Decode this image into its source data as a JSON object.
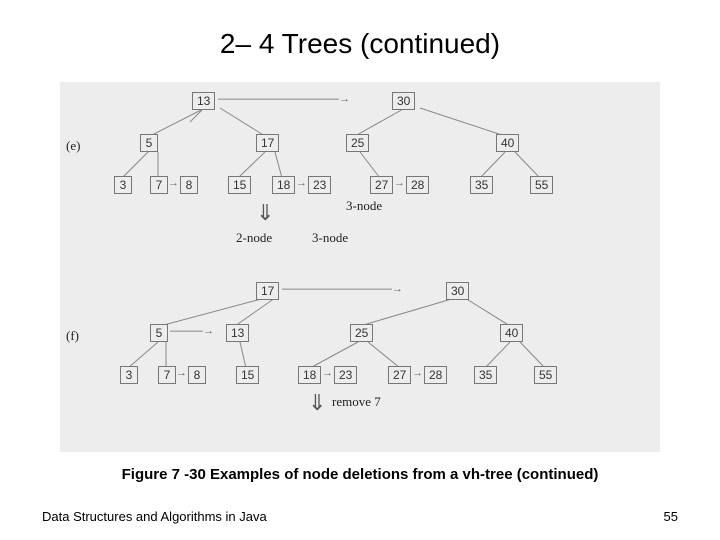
{
  "title": "2– 4 Trees (continued)",
  "panels": {
    "e": {
      "label": "(e)"
    },
    "f": {
      "label": "(f)"
    }
  },
  "treeE": {
    "root": {
      "a": "13",
      "b": "30"
    },
    "l1": {
      "n5": "5",
      "n17": "17",
      "n25": "25",
      "n40": "40"
    },
    "l2": {
      "n3": "3",
      "n7": "7",
      "n8": "8",
      "n15": "15",
      "n18": "18",
      "n23": "23",
      "n27": "27",
      "n28": "28",
      "n35": "35",
      "n55": "55"
    },
    "notes": {
      "threeNode": "3-node",
      "twoNode": "2-node",
      "threeNodeB": "3-node"
    }
  },
  "treeF": {
    "root": {
      "a": "17",
      "b": "30"
    },
    "l1": {
      "n5": "5",
      "n13": "13",
      "n25": "25",
      "n40": "40"
    },
    "l2": {
      "n3": "3",
      "n7": "7",
      "n8": "8",
      "n15": "15",
      "n18": "18",
      "n23": "23",
      "n27": "27",
      "n28": "28",
      "n35": "35",
      "n55": "55"
    },
    "notes": {
      "remove": "remove 7"
    }
  },
  "caption": "Figure 7 -30 Examples of node deletions from a vh-tree (continued)",
  "footer": {
    "left": "Data Structures and Algorithms in Java",
    "right": "55"
  }
}
